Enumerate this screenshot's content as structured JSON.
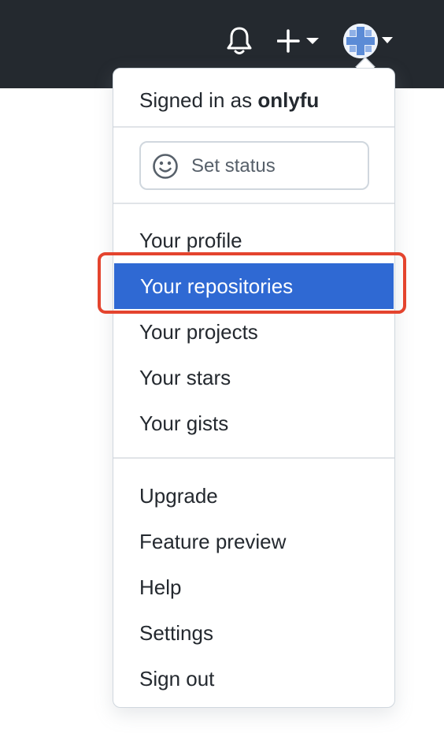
{
  "header": {
    "notifications_icon": "bell-icon",
    "create_icon": "plus-icon",
    "avatar_icon": "user-avatar"
  },
  "dropdown": {
    "signed_in_prefix": "Signed in as ",
    "username": "onlyfu",
    "status": {
      "icon": "smiley-icon",
      "label": "Set status"
    },
    "section1": [
      {
        "label": "Your profile",
        "active": false
      },
      {
        "label": "Your repositories",
        "active": true
      },
      {
        "label": "Your projects",
        "active": false
      },
      {
        "label": "Your stars",
        "active": false
      },
      {
        "label": "Your gists",
        "active": false
      }
    ],
    "section2": [
      {
        "label": "Upgrade"
      },
      {
        "label": "Feature preview"
      },
      {
        "label": "Help"
      },
      {
        "label": "Settings"
      },
      {
        "label": "Sign out"
      }
    ]
  },
  "colors": {
    "topbar": "#24292f",
    "active_item": "#2f69d3",
    "highlight_outline": "#e4442e"
  }
}
